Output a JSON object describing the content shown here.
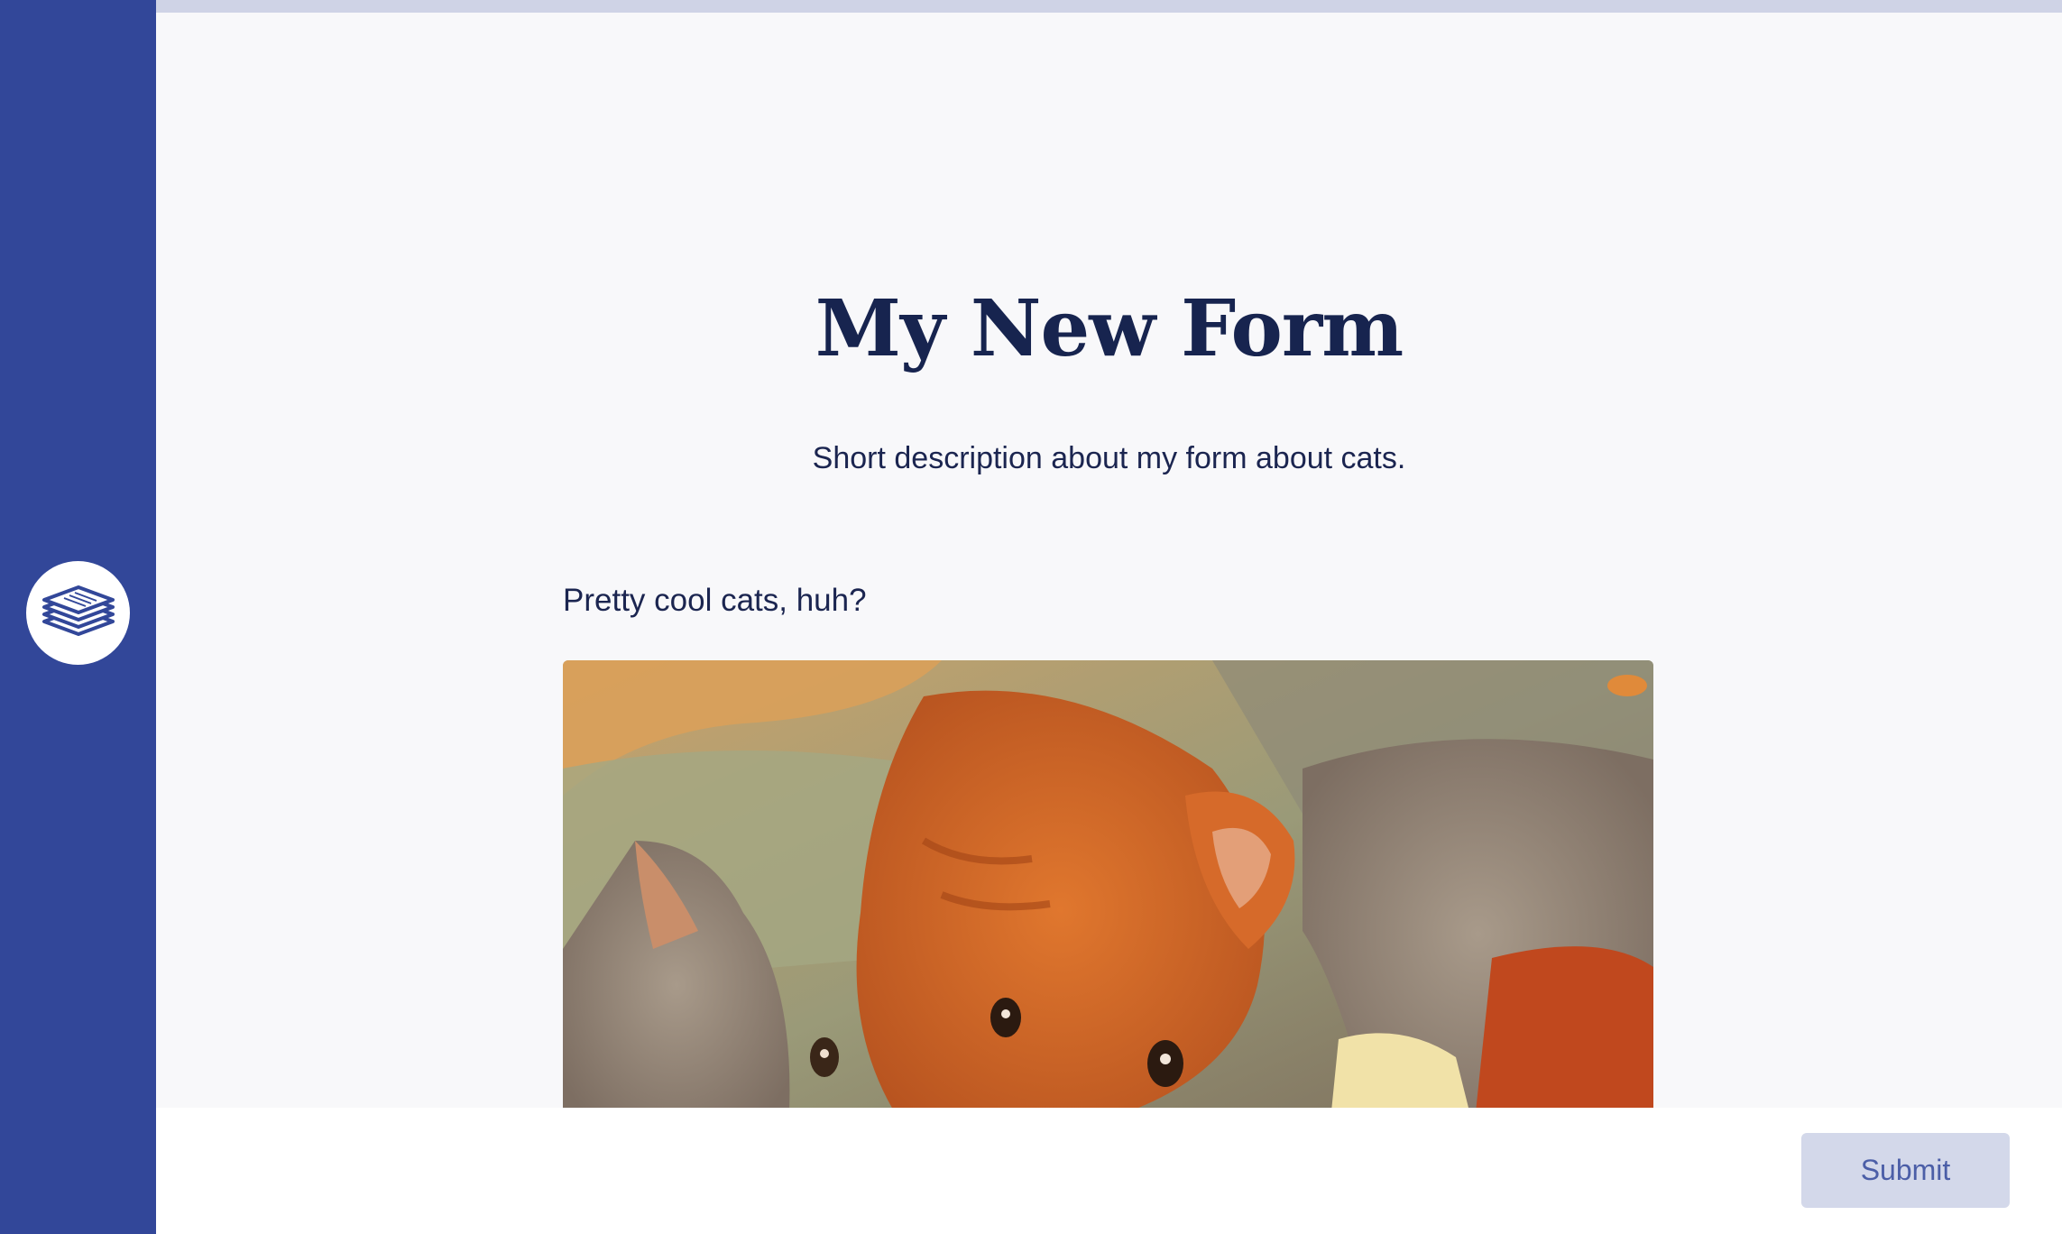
{
  "sidebar": {
    "logo_icon": "stacked-papers-icon"
  },
  "form": {
    "title": "My New Form",
    "description": "Short description about my form about cats.",
    "question": "Pretty cool cats, huh?",
    "image_icon": "cats-photo"
  },
  "footer": {
    "submit_label": "Submit"
  },
  "colors": {
    "sidebar": "#324799",
    "topbar": "#cfd3e6",
    "title": "#17244f",
    "submit_bg": "#d3d8ea",
    "submit_text": "#4b5ea7"
  }
}
